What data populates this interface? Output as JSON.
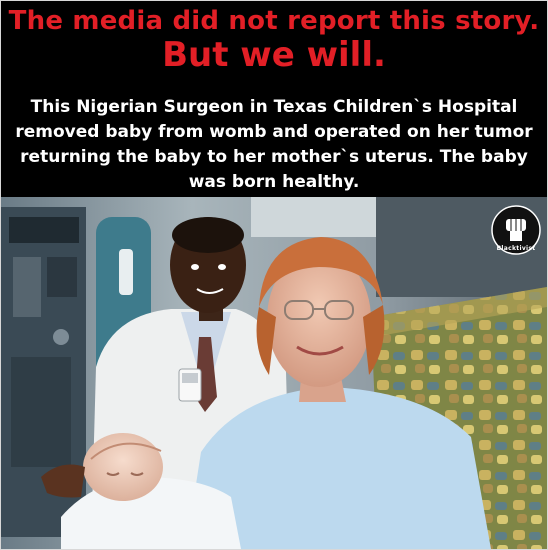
{
  "header": {
    "headline_line1": "The media did not report this story.",
    "headline_line2": "But we will.",
    "caption": "This Nigerian Surgeon in Texas Children`s Hospital removed baby from womb and operated on her tumor returning the baby to her mother`s uterus. The baby was born healthy."
  },
  "photo": {
    "watermark": {
      "label": "Blacktivist",
      "icon": "raised-fist-icon"
    }
  },
  "colors": {
    "background": "#000000",
    "headline": "#e21f26",
    "caption": "#ffffff"
  }
}
